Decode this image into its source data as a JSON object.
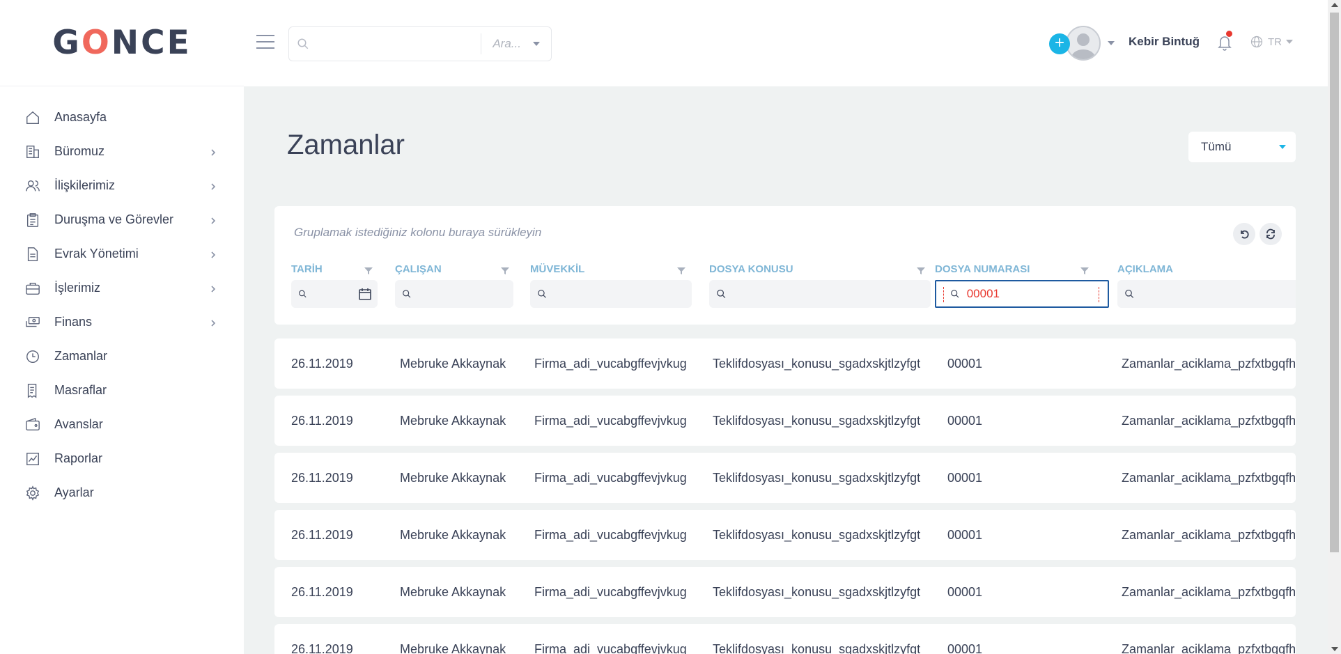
{
  "app": {
    "logo": {
      "part1": "G",
      "part2": "O",
      "part3": "NCE"
    }
  },
  "sidebar": {
    "items": [
      {
        "label": "Anasayfa",
        "icon": "home-icon",
        "has_children": false
      },
      {
        "label": "Büromuz",
        "icon": "building-icon",
        "has_children": true
      },
      {
        "label": "İlişkilerimiz",
        "icon": "users-icon",
        "has_children": true
      },
      {
        "label": "Duruşma ve Görevler",
        "icon": "clipboard-icon",
        "has_children": true
      },
      {
        "label": "Evrak Yönetimi",
        "icon": "document-icon",
        "has_children": true
      },
      {
        "label": "İşlerimiz",
        "icon": "briefcase-icon",
        "has_children": true
      },
      {
        "label": "Finans",
        "icon": "money-icon",
        "has_children": true
      },
      {
        "label": "Zamanlar",
        "icon": "clock-icon",
        "has_children": false
      },
      {
        "label": "Masraflar",
        "icon": "receipt-icon",
        "has_children": false
      },
      {
        "label": "Avanslar",
        "icon": "wallet-icon",
        "has_children": false
      },
      {
        "label": "Raporlar",
        "icon": "chart-icon",
        "has_children": false
      },
      {
        "label": "Ayarlar",
        "icon": "gear-icon",
        "has_children": false
      }
    ]
  },
  "topbar": {
    "search_value": "",
    "search_select": "Ara...",
    "user_name": "Kebir Bintuğ",
    "language": "TR"
  },
  "page": {
    "title": "Zamanlar",
    "filter": "Tümü"
  },
  "grid": {
    "group_hint": "Gruplamak istediğiniz kolonu buraya sürükleyin",
    "columns": [
      {
        "title": "TARİH",
        "filter_value": ""
      },
      {
        "title": "ÇALIŞAN",
        "filter_value": ""
      },
      {
        "title": "MÜVEKKİL",
        "filter_value": ""
      },
      {
        "title": "DOSYA KONUSU",
        "filter_value": ""
      },
      {
        "title": "DOSYA NUMARASI",
        "filter_value": "00001"
      },
      {
        "title": "AÇIKLAMA",
        "filter_value": ""
      }
    ],
    "rows": [
      {
        "tarih": "26.11.2019",
        "calisan": "Mebruke Akkaynak",
        "muvekkil": "Firma_adi_vucabgffevjvkug",
        "konu": "Teklifdosyası_konusu_sgadxskjtlzyfgt",
        "numara": "00001",
        "aciklama": "Zamanlar_aciklama_pzfxtbgqfh"
      },
      {
        "tarih": "26.11.2019",
        "calisan": "Mebruke Akkaynak",
        "muvekkil": "Firma_adi_vucabgffevjvkug",
        "konu": "Teklifdosyası_konusu_sgadxskjtlzyfgt",
        "numara": "00001",
        "aciklama": "Zamanlar_aciklama_pzfxtbgqfh"
      },
      {
        "tarih": "26.11.2019",
        "calisan": "Mebruke Akkaynak",
        "muvekkil": "Firma_adi_vucabgffevjvkug",
        "konu": "Teklifdosyası_konusu_sgadxskjtlzyfgt",
        "numara": "00001",
        "aciklama": "Zamanlar_aciklama_pzfxtbgqfh"
      },
      {
        "tarih": "26.11.2019",
        "calisan": "Mebruke Akkaynak",
        "muvekkil": "Firma_adi_vucabgffevjvkug",
        "konu": "Teklifdosyası_konusu_sgadxskjtlzyfgt",
        "numara": "00001",
        "aciklama": "Zamanlar_aciklama_pzfxtbgqfh"
      },
      {
        "tarih": "26.11.2019",
        "calisan": "Mebruke Akkaynak",
        "muvekkil": "Firma_adi_vucabgffevjvkug",
        "konu": "Teklifdosyası_konusu_sgadxskjtlzyfgt",
        "numara": "00001",
        "aciklama": "Zamanlar_aciklama_pzfxtbgqfh"
      },
      {
        "tarih": "26.11.2019",
        "calisan": "Mebruke Akkaynak",
        "muvekkil": "Firma_adi_vucabgffevjvkug",
        "konu": "Teklifdosyası_konusu_sgadxskjtlzyfgt",
        "numara": "00001",
        "aciklama": "Zamanlar_aciklama_pzfxtbgqfh"
      }
    ]
  },
  "colors": {
    "accent": "#1bb5e6",
    "column_title": "#7fb6d6",
    "active_border": "#1e5aa0",
    "logo_accent": "#f0685c",
    "notification": "#e8382f"
  }
}
